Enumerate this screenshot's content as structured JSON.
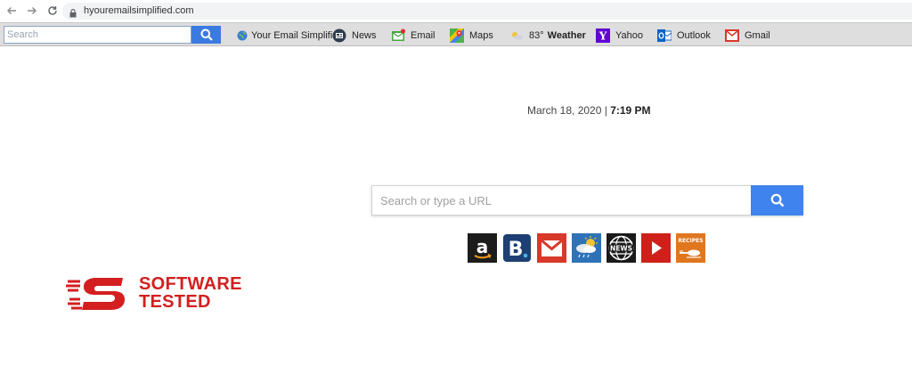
{
  "browser": {
    "url": "hyouremailsimplified.com"
  },
  "toolbar": {
    "search_placeholder": "Search",
    "items": [
      {
        "label": "Your Email Simplified",
        "icon": "globe-icon"
      },
      {
        "label": "News",
        "icon": "news-icon"
      },
      {
        "label": "Email",
        "icon": "email-icon"
      },
      {
        "label": "Maps",
        "icon": "maps-icon"
      },
      {
        "label": "83°",
        "label_bold": "Weather",
        "icon": "weather-icon"
      },
      {
        "label": "Yahoo",
        "icon": "yahoo-icon"
      },
      {
        "label": "Outlook",
        "icon": "outlook-icon"
      },
      {
        "label": "Gmail",
        "icon": "gmail-icon"
      }
    ]
  },
  "main": {
    "date": "March 18, 2020",
    "separator": "|",
    "time": "7:19 PM",
    "search_placeholder": "Search or type a URL"
  },
  "tiles": [
    {
      "name": "amazon-tile",
      "icon": "amazon-icon"
    },
    {
      "name": "booking-tile",
      "icon": "booking-icon",
      "text": "B"
    },
    {
      "name": "gmail-tile",
      "icon": "gmail-icon"
    },
    {
      "name": "weather-tile",
      "icon": "weather-icon"
    },
    {
      "name": "news-tile",
      "icon": "news-icon",
      "text": "NEWS"
    },
    {
      "name": "youtube-tile",
      "icon": "youtube-icon"
    },
    {
      "name": "recipes-tile",
      "icon": "recipes-icon",
      "text": "RECIPES"
    }
  ],
  "watermark": {
    "line1": "SOFTWARE",
    "line2": "TESTED"
  },
  "colors": {
    "accent_blue": "#3f84ee",
    "toolbar_bg": "#dedede",
    "brand_red": "#d31f1f"
  }
}
